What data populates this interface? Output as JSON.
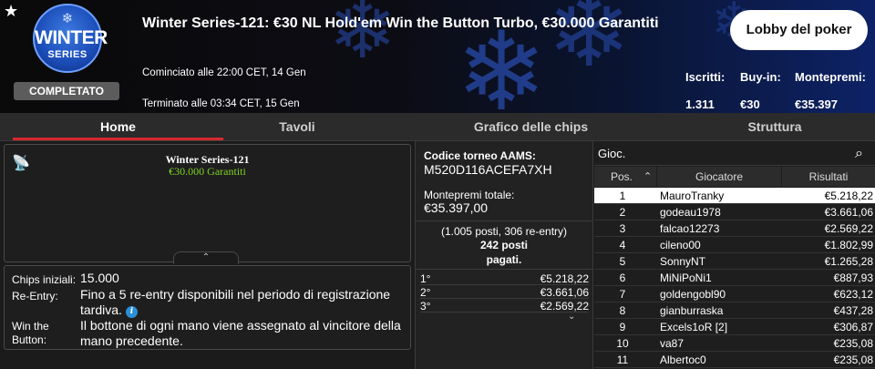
{
  "header": {
    "logo_line1": "WINTER",
    "logo_line2": "SERIES",
    "status": "COMPLETATO",
    "title": "Winter Series-121: €30 NL Hold'em Win the Button Turbo, €30.000 Garantiti",
    "started": "Cominciato alle 22:00 CET, 14 Gen",
    "ended": "Terminato alle 03:34 CET, 15 Gen",
    "lobby_button": "Lobby del poker",
    "stats": [
      {
        "label": "Iscritti:",
        "value": "1.311"
      },
      {
        "label": "Buy-in:",
        "value": "€30"
      },
      {
        "label": "Montepremi:",
        "value": "€35.397"
      }
    ]
  },
  "tabs": [
    "Home",
    "Tavoli",
    "Grafico delle chips",
    "Struttura"
  ],
  "info_card": {
    "name": "Winter Series-121",
    "guarantee": "€30.000 Garantiti"
  },
  "details": {
    "chips_label": "Chips iniziali:",
    "chips_value": "15.000",
    "reentry_label": "Re-Entry:",
    "reentry_value": "Fino a 5 re-entry disponibili nel periodo di registrazione tardiva.",
    "wtb_label_1": "Win the",
    "wtb_label_2": "Button:",
    "wtb_value": "Il bottone di ogni mano viene assegnato al vincitore della mano precedente."
  },
  "middle": {
    "code_label": "Codice torneo AAMS:",
    "code_value": "M520D116ACEFA7XH",
    "total_label": "Montepremi totale:",
    "total_value": "€35.397,00",
    "entries_line": "(1.005 posti, 306 re-entry)",
    "paid_line1": "242 posti",
    "paid_line2": "pagati.",
    "prizes": [
      {
        "pos": "1°",
        "amount": "€5.218,22"
      },
      {
        "pos": "2°",
        "amount": "€3.661,06"
      },
      {
        "pos": "3°",
        "amount": "€2.569,22"
      }
    ]
  },
  "players": {
    "search_placeholder": "Gioc.",
    "col_pos": "Pos.",
    "col_player": "Giocatore",
    "col_result": "Risultati",
    "rows": [
      {
        "pos": "1",
        "name": "MauroTranky",
        "result": "€5.218,22"
      },
      {
        "pos": "2",
        "name": "godeau1978",
        "result": "€3.661,06"
      },
      {
        "pos": "3",
        "name": "falcao12273",
        "result": "€2.569,22"
      },
      {
        "pos": "4",
        "name": "cileno00",
        "result": "€1.802,99"
      },
      {
        "pos": "5",
        "name": "SonnyNT",
        "result": "€1.265,28"
      },
      {
        "pos": "6",
        "name": "MiNiPoNi1",
        "result": "€887,93"
      },
      {
        "pos": "7",
        "name": "goldengobl90",
        "result": "€623,12"
      },
      {
        "pos": "8",
        "name": "gianburraska",
        "result": "€437,28"
      },
      {
        "pos": "9",
        "name": "Excels1oR [2]",
        "result": "€306,87"
      },
      {
        "pos": "10",
        "name": "va87",
        "result": "€235,08"
      },
      {
        "pos": "11",
        "name": "Albertoc0",
        "result": "€235,08"
      }
    ]
  },
  "icons": {
    "favorite": "star-icon",
    "live": "antenna-icon",
    "search": "search-icon",
    "info": "info-icon"
  },
  "colors": {
    "accent_red": "#d7282f",
    "guarantee_green": "#7ed321",
    "info_blue": "#2a8fd6"
  }
}
